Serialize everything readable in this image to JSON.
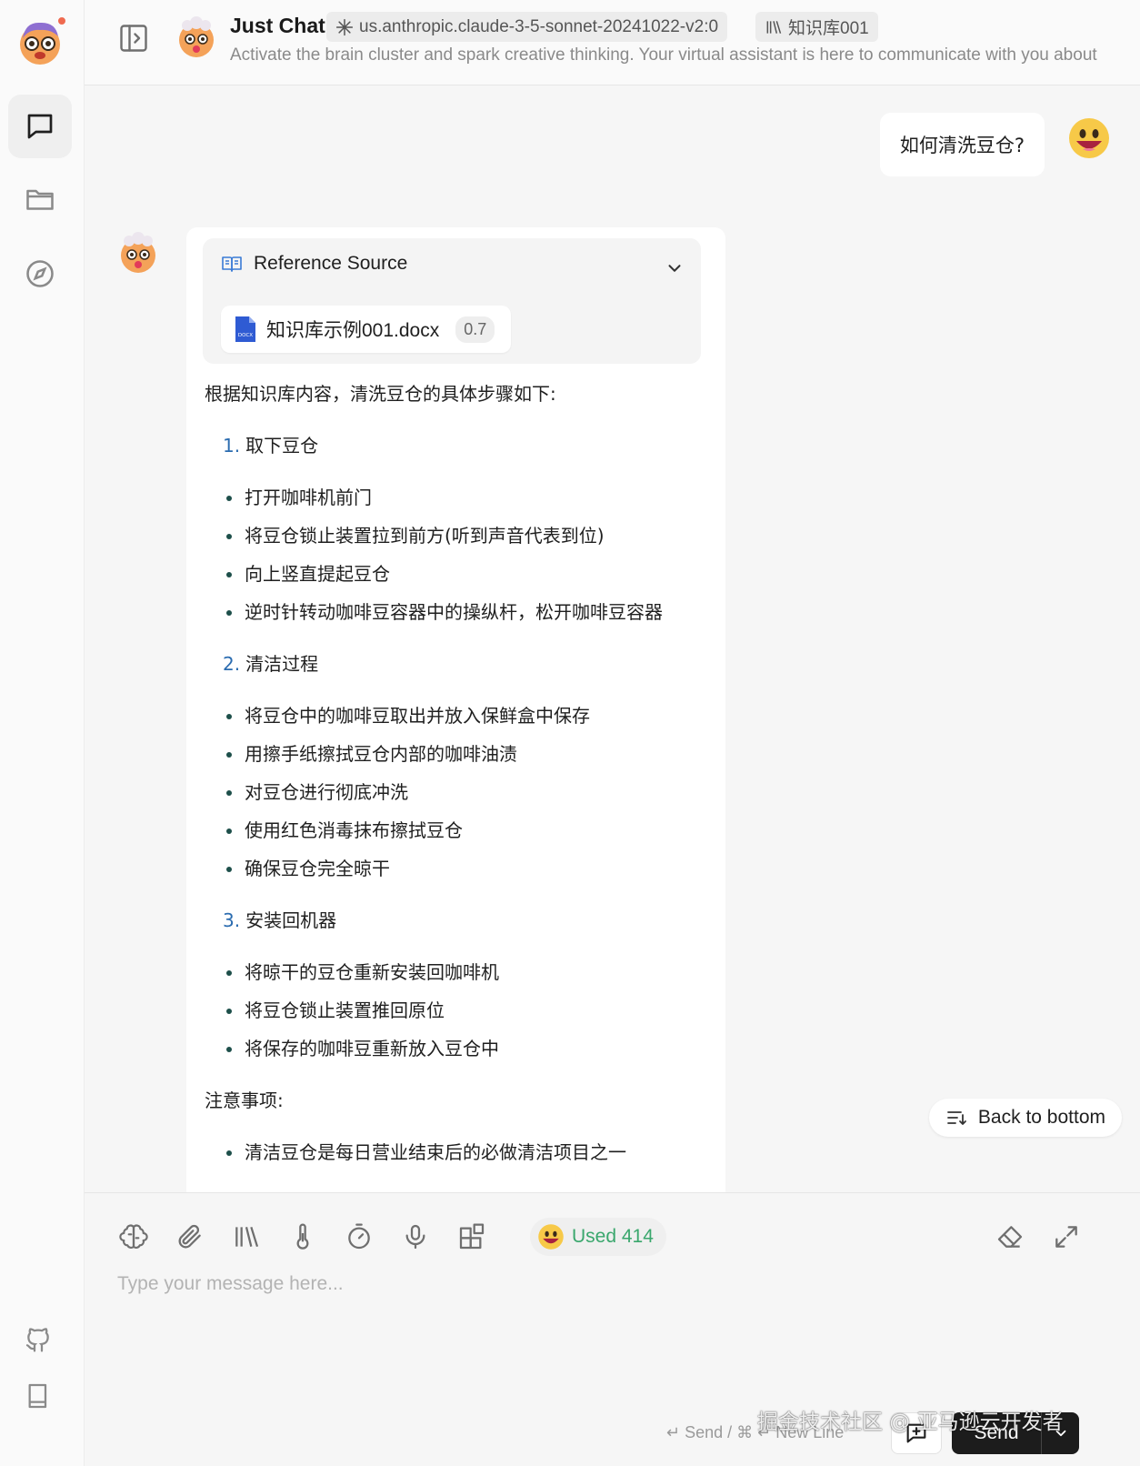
{
  "header": {
    "title": "Just Chat",
    "model_tag": "us.anthropic.claude-3-5-sonnet-20241022-v2:0",
    "kb_tag": "知识库001",
    "description": "Activate the brain cluster and spark creative thinking. Your virtual assistant is here to communicate with you about"
  },
  "chat": {
    "user_message": "如何清洗豆仓?",
    "reference": {
      "label": "Reference Source",
      "file_name": "知识库示例001.docx",
      "score": "0.7",
      "file_icon_text": "DOCX"
    },
    "answer": {
      "intro": "根据知识库内容，清洗豆仓的具体步骤如下:",
      "steps": [
        {
          "num": "1.",
          "title": "取下豆仓",
          "items": [
            "打开咖啡机前门",
            "将豆仓锁止装置拉到前方(听到声音代表到位)",
            "向上竖直提起豆仓",
            "逆时针转动咖啡豆容器中的操纵杆，松开咖啡豆容器"
          ]
        },
        {
          "num": "2.",
          "title": "清洁过程",
          "items": [
            "将豆仓中的咖啡豆取出并放入保鲜盒中保存",
            "用擦手纸擦拭豆仓内部的咖啡油渍",
            "对豆仓进行彻底冲洗",
            "使用红色消毒抹布擦拭豆仓",
            "确保豆仓完全晾干"
          ]
        },
        {
          "num": "3.",
          "title": "安装回机器",
          "items": [
            "将晾干的豆仓重新安装回咖啡机",
            "将豆仓锁止装置推回原位",
            "将保存的咖啡豆重新放入豆仓中"
          ]
        }
      ],
      "notes_title": "注意事项:",
      "notes": [
        "清洁豆仓是每日营业结束后的必做清洁项目之一"
      ]
    },
    "back_to_bottom": "Back to bottom"
  },
  "input": {
    "usage_label": "Used 414",
    "placeholder": "Type your message here...",
    "hint": "↵ Send / ⌘ ↵ New Line",
    "send_label": "Send"
  },
  "watermark": "掘金技术社区 @ 亚马逊云开发者",
  "colors": {
    "accent_blue": "#2b6cb0",
    "usage_green": "#3aa76d",
    "notification_dot": "#ef6a4f",
    "send_button": "#1c1c1c"
  }
}
